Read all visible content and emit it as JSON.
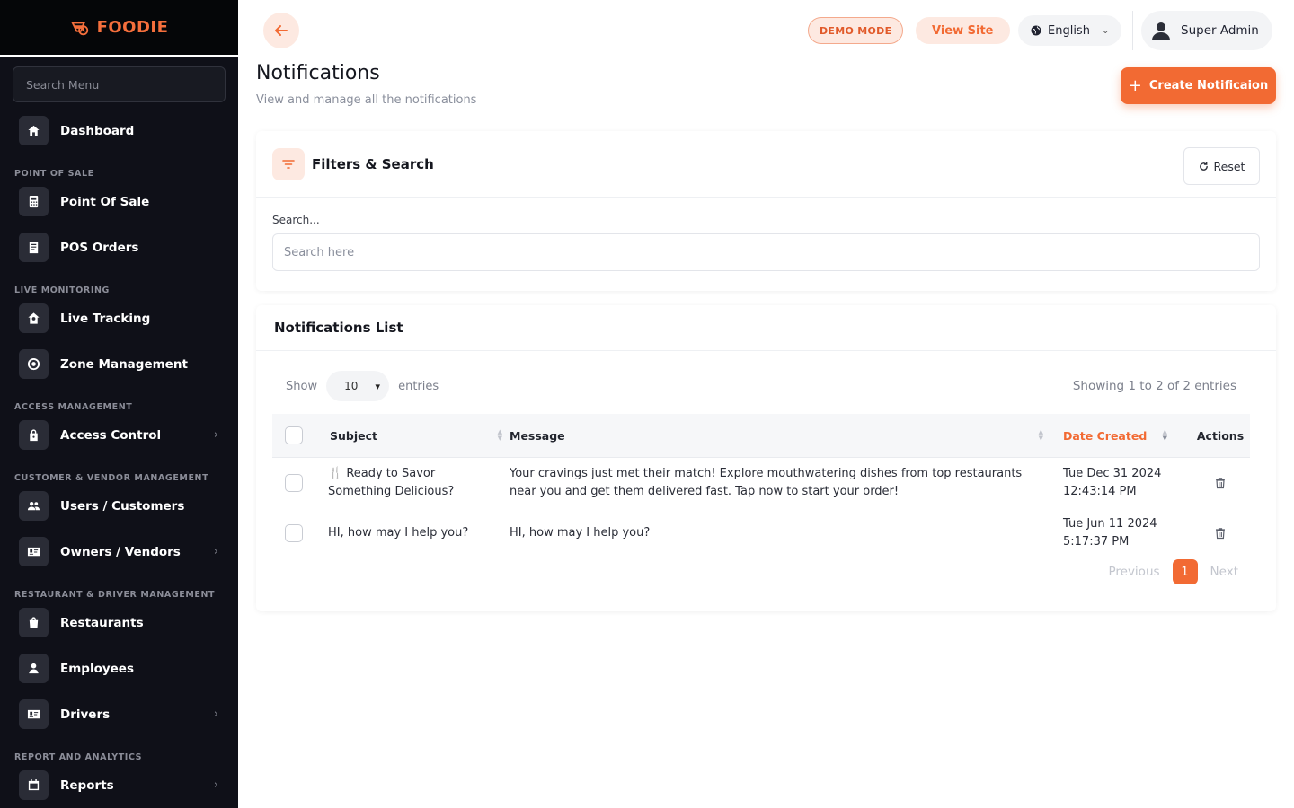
{
  "brand": {
    "name": "FOODIE",
    "color": "#f56f3c"
  },
  "sidebar": {
    "search_placeholder": "Search Menu",
    "dashboard": {
      "label": "Dashboard",
      "icon": "home-icon"
    },
    "sections": [
      {
        "title": "POINT OF SALE",
        "items": [
          {
            "label": "Point Of Sale",
            "icon": "calculator-icon",
            "chevron": false
          },
          {
            "label": "POS Orders",
            "icon": "receipt-icon",
            "chevron": false
          }
        ]
      },
      {
        "title": "LIVE MONITORING",
        "items": [
          {
            "label": "Live Tracking",
            "icon": "tracking-icon",
            "chevron": false
          },
          {
            "label": "Zone Management",
            "icon": "target-icon",
            "chevron": false
          }
        ]
      },
      {
        "title": "ACCESS MANAGEMENT",
        "items": [
          {
            "label": "Access Control",
            "icon": "lock-icon",
            "chevron": true
          }
        ]
      },
      {
        "title": "CUSTOMER & VENDOR MANAGEMENT",
        "items": [
          {
            "label": "Users / Customers",
            "icon": "users-icon",
            "chevron": false
          },
          {
            "label": "Owners / Vendors",
            "icon": "id-card-icon",
            "chevron": true
          }
        ]
      },
      {
        "title": "RESTAURANT & DRIVER MANAGEMENT",
        "items": [
          {
            "label": "Restaurants",
            "icon": "bag-icon",
            "chevron": false
          },
          {
            "label": "Employees",
            "icon": "person-icon",
            "chevron": false
          },
          {
            "label": "Drivers",
            "icon": "id-card-icon",
            "chevron": true
          }
        ]
      },
      {
        "title": "REPORT AND ANALYTICS",
        "items": [
          {
            "label": "Reports",
            "icon": "calendar-icon",
            "chevron": true
          }
        ]
      }
    ]
  },
  "topbar": {
    "demo_badge": "DEMO MODE",
    "view_site": "View Site",
    "language": "English",
    "user_name": "Super Admin",
    "accent": "#f26a33"
  },
  "page": {
    "title": "Notifications",
    "subtitle": "View and manage all the notifications",
    "create_button": "Create Notificaion"
  },
  "filters": {
    "title": "Filters & Search",
    "reset": "Reset",
    "search_label": "Search...",
    "search_placeholder": "Search here",
    "search_value": ""
  },
  "list": {
    "title": "Notifications List",
    "show_label": "Show",
    "page_size": "10",
    "entries_label": "entries",
    "showing": "Showing 1 to 2 of 2 entries",
    "columns": {
      "subject": "Subject",
      "message": "Message",
      "date": "Date Created",
      "actions": "Actions"
    },
    "rows": [
      {
        "subject_line1": "🍴 Ready to Savor",
        "subject_line2": "Something Delicious?",
        "message_line1": "Your cravings just met their match! Explore mouthwatering dishes from top restaurants",
        "message_line2": "near you and get them delivered fast. Tap now to start your order!",
        "date_line1": "Tue Dec 31 2024",
        "date_line2": "12:43:14 PM"
      },
      {
        "subject_line1": "HI, how may I help you?",
        "subject_line2": "",
        "message_line1": "HI, how may I help you?",
        "message_line2": "",
        "date_line1": "Tue Jun 11 2024",
        "date_line2": "5:17:37 PM"
      }
    ],
    "pagination": {
      "previous": "Previous",
      "current": "1",
      "next": "Next"
    }
  }
}
